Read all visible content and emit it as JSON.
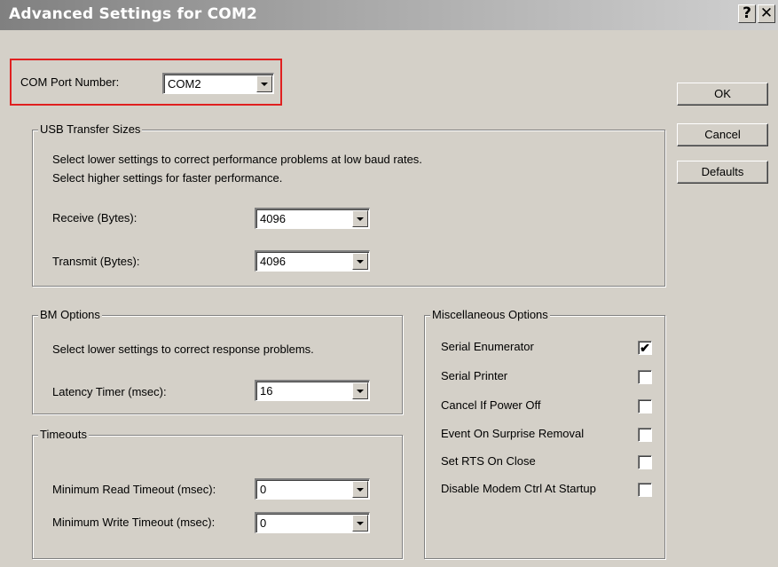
{
  "window": {
    "title": "Advanced Settings for COM2",
    "help_btn": "?",
    "close_btn": "✕"
  },
  "com_port": {
    "label": "COM Port Number:",
    "value": "COM2"
  },
  "usb": {
    "title": "USB Transfer Sizes",
    "desc1": "Select lower settings to correct performance problems at low baud rates.",
    "desc2": "Select higher settings for faster performance.",
    "receive_label": "Receive (Bytes):",
    "receive_value": "4096",
    "transmit_label": "Transmit (Bytes):",
    "transmit_value": "4096"
  },
  "bm": {
    "title": "BM Options",
    "desc": "Select lower settings to correct response problems.",
    "latency_label": "Latency Timer (msec):",
    "latency_value": "16"
  },
  "timeouts": {
    "title": "Timeouts",
    "read_label": "Minimum Read Timeout (msec):",
    "read_value": "0",
    "write_label": "Minimum Write Timeout (msec):",
    "write_value": "0"
  },
  "misc": {
    "title": "Miscellaneous Options",
    "items": [
      {
        "label": "Serial Enumerator",
        "checked": true
      },
      {
        "label": "Serial Printer",
        "checked": false
      },
      {
        "label": "Cancel If Power Off",
        "checked": false
      },
      {
        "label": "Event On Surprise Removal",
        "checked": false
      },
      {
        "label": "Set RTS On Close",
        "checked": false
      },
      {
        "label": "Disable Modem Ctrl At Startup",
        "checked": false
      }
    ]
  },
  "buttons": {
    "ok": "OK",
    "cancel": "Cancel",
    "defaults": "Defaults"
  },
  "check_glyph": "✔"
}
